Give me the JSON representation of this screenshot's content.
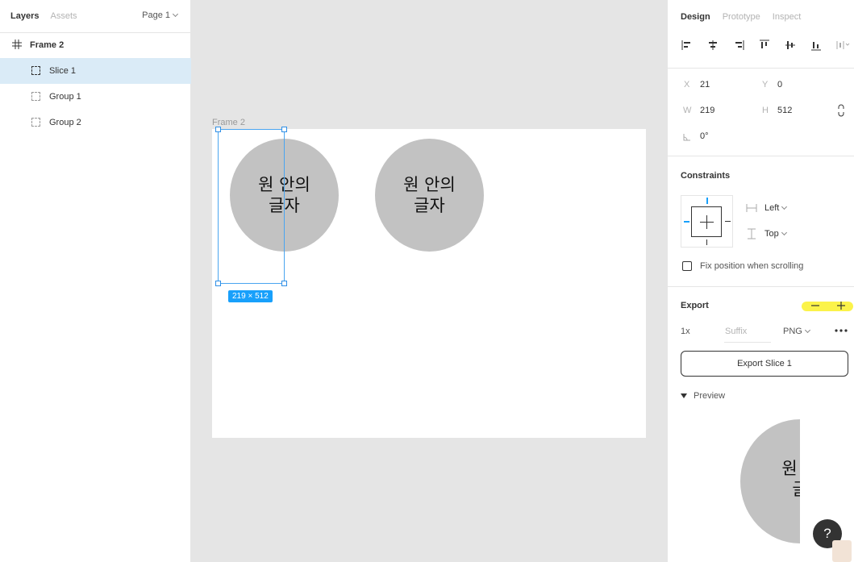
{
  "left_panel": {
    "tabs": [
      "Layers",
      "Assets"
    ],
    "page_selector": "Page 1",
    "layers": [
      {
        "name": "Frame 2",
        "type": "frame"
      },
      {
        "name": "Slice 1",
        "type": "slice",
        "selected": true
      },
      {
        "name": "Group 1",
        "type": "group"
      },
      {
        "name": "Group 2",
        "type": "group"
      }
    ]
  },
  "canvas": {
    "frame_label": "Frame 2",
    "circles": [
      {
        "line1": "원 안의",
        "line2": "글자"
      },
      {
        "line1": "원 안의",
        "line2": "글자"
      }
    ],
    "selection_size": "219 × 512"
  },
  "right_panel": {
    "tabs": [
      "Design",
      "Prototype",
      "Inspect"
    ],
    "position": {
      "x_label": "X",
      "x": "21",
      "y_label": "Y",
      "y": "0"
    },
    "size": {
      "w_label": "W",
      "w": "219",
      "h_label": "H",
      "h": "512"
    },
    "rotation": "0°",
    "constraints": {
      "title": "Constraints",
      "horizontal": "Left",
      "vertical": "Top"
    },
    "fix_position_label": "Fix position when scrolling",
    "export": {
      "title": "Export",
      "scale": "1x",
      "suffix_placeholder": "Suffix",
      "format": "PNG",
      "button_label": "Export Slice 1",
      "preview_label": "Preview",
      "preview_text_line1": "원 안",
      "preview_text_line2": "글"
    },
    "help_label": "?"
  },
  "colors": {
    "selection_blue": "#18a0fb",
    "layer_selected_bg": "#daebf7",
    "circle_fill": "#c2c2c2",
    "highlight_yellow": "#fbf34a"
  }
}
